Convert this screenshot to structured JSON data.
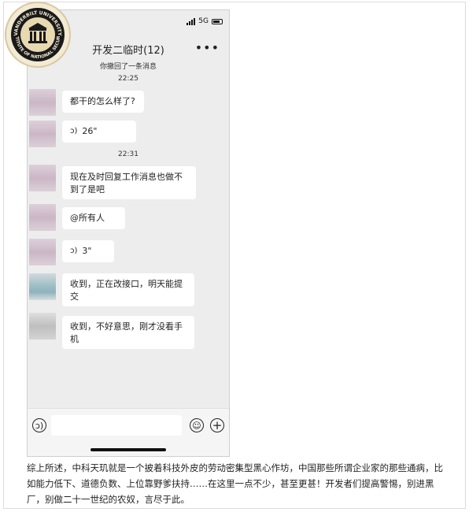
{
  "watermark": {
    "top_text": "VANDERBILT UNIVERSITY",
    "bottom_text": "INSTITUTE OF NATIONAL SECURITY"
  },
  "status_bar": {
    "network": "5G"
  },
  "chat": {
    "title": "开发二临时(12)",
    "system_message": "你撤回了一条消息",
    "timestamps": [
      "22:25",
      "22:31"
    ],
    "messages": [
      {
        "type": "text",
        "text": "都干的怎么样了?"
      },
      {
        "type": "voice",
        "duration": "26\""
      },
      {
        "type": "text",
        "text": "现在及时回复工作消息也做不到了是吧"
      },
      {
        "type": "text",
        "text": "@所有人"
      },
      {
        "type": "voice",
        "duration": "3\""
      },
      {
        "type": "text",
        "text": "收到，正在改接口，明天能提交"
      },
      {
        "type": "text",
        "text": "收到，不好意思，刚才没看手机"
      }
    ]
  },
  "icons": {
    "more": "more-icon",
    "voice": "voice-icon",
    "emoji": "emoji-icon",
    "add": "add-icon"
  },
  "article": {
    "paragraph": "综上所述，中科天玑就是一个披着科技外皮的劳动密集型黑心作坊，中国那些所谓企业家的那些通病，比如能力低下、道德负数、上位靠野爹扶持……在这里一点不少，甚至更甚！开发者们提高警惕，别进黑厂，别做二十一世纪的农奴，言尽于此。"
  }
}
